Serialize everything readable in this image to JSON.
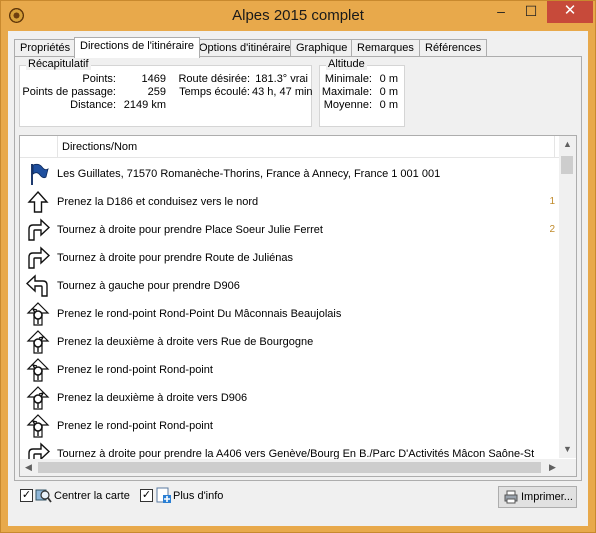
{
  "window": {
    "title": "Alpes 2015 complet",
    "controls": {
      "minimize": "–",
      "maximize": "☐",
      "close": "✕"
    }
  },
  "tabs": [
    {
      "label": "Propriétés",
      "active": false
    },
    {
      "label": "Directions de l'itinéraire",
      "active": true
    },
    {
      "label": "Options d'itinéraire",
      "active": false
    },
    {
      "label": "Graphique",
      "active": false
    },
    {
      "label": "Remarques",
      "active": false
    },
    {
      "label": "Références",
      "active": false
    }
  ],
  "recap": {
    "label": "Récapitulatif",
    "points_label": "Points:",
    "points_value": "1469",
    "waypoints_label": "Points de passage:",
    "waypoints_value": "259",
    "distance_label": "Distance:",
    "distance_value": "2149 km",
    "route_label": "Route désirée:",
    "route_value": "181.3° vrai",
    "time_label": "Temps écoulé:",
    "time_value": "43 h, 47 min"
  },
  "altitude": {
    "label": "Altitude",
    "min_label": "Minimale:",
    "min_value": "0 m",
    "max_label": "Maximale:",
    "max_value": "0 m",
    "avg_label": "Moyenne:",
    "avg_value": "0 m"
  },
  "list": {
    "column_header": "Directions/Nom",
    "rows": [
      {
        "icon": "flag-icon",
        "text": "Les Guillates, 71570 Romanèche-Thorins, France à Annecy, France 1 001 001",
        "tail": ""
      },
      {
        "icon": "straight-arrow-icon",
        "text": "Prenez la  D186 et conduisez vers le nord",
        "tail": "1"
      },
      {
        "icon": "turn-right-icon",
        "text": "Tournez à droite pour prendre Place Soeur Julie Ferret",
        "tail": "2"
      },
      {
        "icon": "turn-right-icon",
        "text": "Tournez à droite pour prendre Route de Juliénas",
        "tail": ""
      },
      {
        "icon": "turn-left-icon",
        "text": "Tournez à gauche pour prendre  D906",
        "tail": ""
      },
      {
        "icon": "roundabout-icon",
        "text": "Prenez le rond-point Rond-Point Du Mâconnais Beaujolais",
        "tail": ""
      },
      {
        "icon": "roundabout-icon",
        "text": "Prenez la deuxième à droite vers Rue de Bourgogne",
        "tail": ""
      },
      {
        "icon": "roundabout-icon",
        "text": "Prenez le rond-point Rond-point",
        "tail": ""
      },
      {
        "icon": "roundabout-icon",
        "text": "Prenez la deuxième à droite vers  D906",
        "tail": ""
      },
      {
        "icon": "roundabout-icon",
        "text": "Prenez le rond-point Rond-point",
        "tail": ""
      },
      {
        "icon": "turn-right-icon",
        "text": "Tournez à droite pour prendre la A406 vers Genève/Bourg En B./Parc D'Activités Mâcon Saône-St",
        "tail": ""
      }
    ]
  },
  "footer": {
    "center_map_label": "Centrer la carte",
    "center_map_checked": true,
    "more_info_label": "Plus d'info",
    "more_info_checked": true,
    "print_label": "Imprimer..."
  }
}
